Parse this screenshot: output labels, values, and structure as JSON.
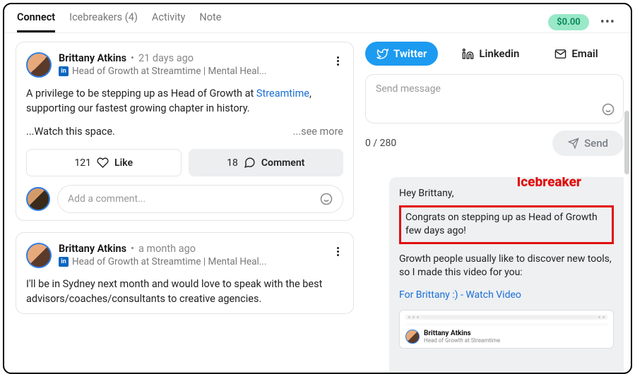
{
  "topbar": {
    "tabs": {
      "connect": "Connect",
      "icebreakers": "Icebreakers (4)",
      "activity": "Activity",
      "note": "Note"
    },
    "balance": "$0.00"
  },
  "posts": [
    {
      "author": "Brittany Atkins",
      "time": "21 days ago",
      "subtitle": "Head of Growth at Streamtime | Mental Heal...",
      "body_prefix": "A privilege to be stepping up as Head of Growth at ",
      "body_link": "Streamtime",
      "body_suffix": ", supporting our fastest growing chapter in history.",
      "watch": "...Watch this space.",
      "see_more": "...see more",
      "like_count": "121",
      "like_label": "Like",
      "comment_count": "18",
      "comment_label": "Comment",
      "comment_placeholder": "Add a comment..."
    },
    {
      "author": "Brittany Atkins",
      "time": "a month ago",
      "subtitle": "Head of Growth at Streamtime | Mental Heal...",
      "body": "I'll be in Sydney next month and would love to speak with the best advisors/coaches/consultants to creative agencies."
    }
  ],
  "right": {
    "channels": {
      "twitter": "Twitter",
      "linkedin": "Linkedin",
      "email": "Email"
    },
    "compose_placeholder": "Send message",
    "counter": "0 / 280",
    "send": "Send",
    "annotation": "Icebreaker",
    "preview": {
      "greeting": "Hey Brittany,",
      "highlight": "Congrats on stepping up as Head of Growth few days ago!",
      "line2": "Growth people usually like to discover new tools, so I made this video for you:",
      "link": "For Brittany :) - Watch Video",
      "thumb_name": "Brittany Atkins",
      "thumb_sub": "Head of Growth at Streamtime"
    }
  }
}
